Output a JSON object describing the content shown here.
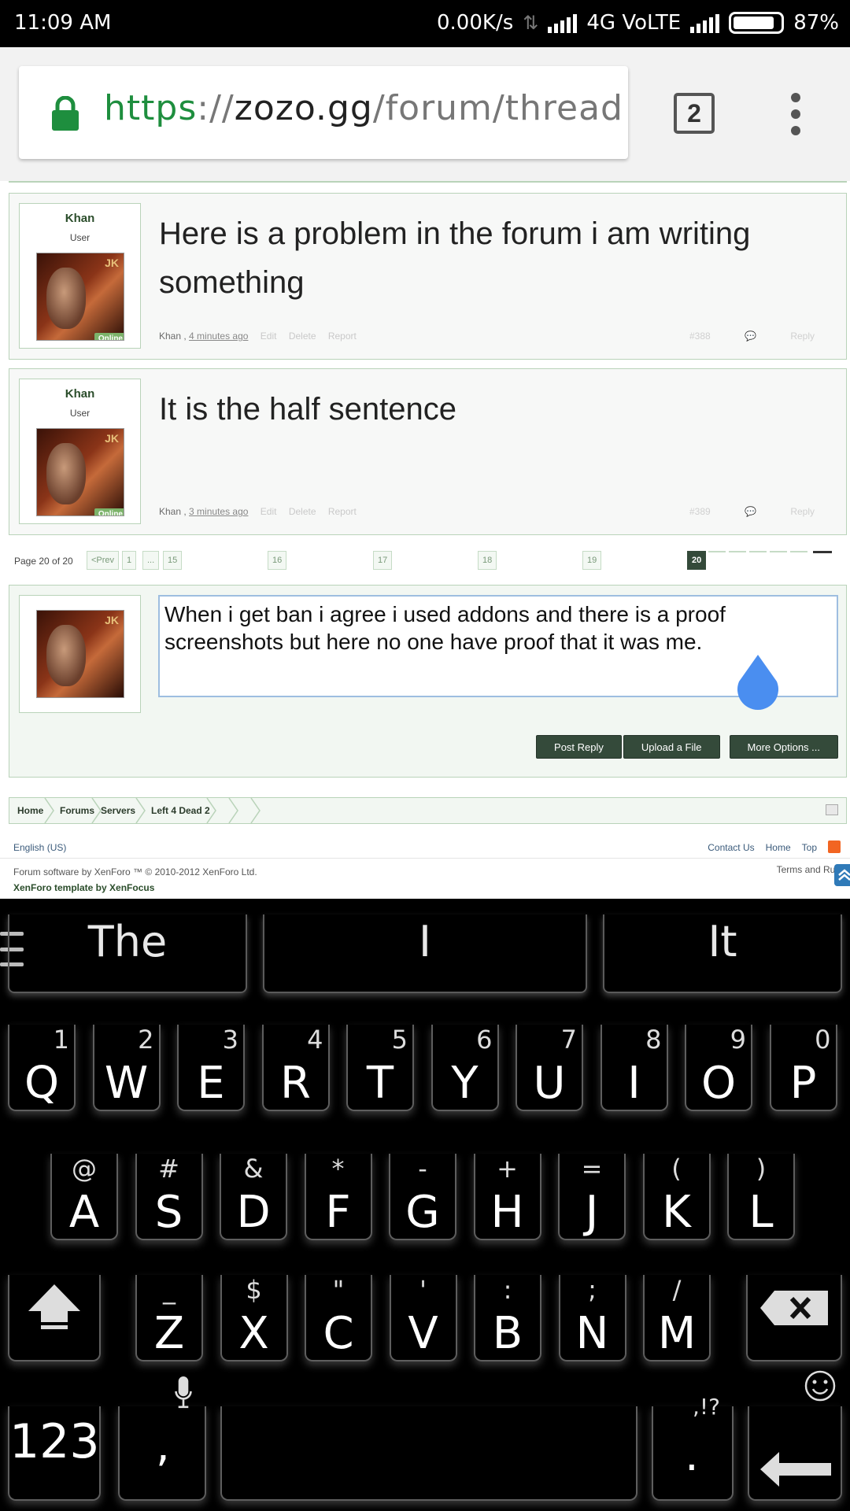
{
  "status_bar": {
    "time": "11:09 AM",
    "net_speed": "0.00K/s",
    "network": "4G VoLTE",
    "battery": "87%"
  },
  "browser": {
    "url_scheme": "https",
    "url_sep": "://",
    "url_host": "zozo.gg",
    "url_path": "/forum/thread",
    "tab_count": "2"
  },
  "posts": [
    {
      "username": "Khan",
      "role": "User",
      "online_badge": "Online",
      "message": "Here is a problem in the forum i am writing something",
      "author": "Khan",
      "time": "4 minutes ago",
      "actions": [
        "Edit",
        "Delete",
        "Report"
      ],
      "number": "#388",
      "reply_label": "Reply"
    },
    {
      "username": "Khan",
      "role": "User",
      "online_badge": "Online",
      "message": "It is the half sentence",
      "author": "Khan",
      "time": "3 minutes ago",
      "actions": [
        "Edit",
        "Delete",
        "Report"
      ],
      "number": "#389",
      "reply_label": "Reply"
    }
  ],
  "pagination": {
    "label": "Page 20 of 20",
    "prev": "<Prev",
    "first": "1",
    "ellipsis": "...",
    "pages": [
      "15",
      "16",
      "17",
      "18",
      "19"
    ],
    "current": "20"
  },
  "reply_box": {
    "text": "When i get ban i agree i used addons and there is a proof screenshots but  here no one have proof that it was me.",
    "post_reply": "Post Reply",
    "upload": "Upload a File",
    "more_options": "More Options ..."
  },
  "breadcrumb": [
    "Home",
    "Forums",
    "Servers",
    "Left 4 Dead 2"
  ],
  "footer": {
    "language": "English (US)",
    "links": [
      "Contact Us",
      "Home",
      "Top"
    ],
    "copyright": "Forum software by XenForo ™ © 2010-2012 XenForo Ltd.",
    "template": "XenForo template by XenFocus",
    "terms": "Terms and Rul"
  },
  "keyboard": {
    "suggestions": [
      "The",
      "I",
      "It"
    ],
    "row1": [
      {
        "k": "Q",
        "h": "1"
      },
      {
        "k": "W",
        "h": "2"
      },
      {
        "k": "E",
        "h": "3"
      },
      {
        "k": "R",
        "h": "4"
      },
      {
        "k": "T",
        "h": "5"
      },
      {
        "k": "Y",
        "h": "6"
      },
      {
        "k": "U",
        "h": "7"
      },
      {
        "k": "I",
        "h": "8"
      },
      {
        "k": "O",
        "h": "9"
      },
      {
        "k": "P",
        "h": "0"
      }
    ],
    "row2": [
      {
        "k": "A",
        "h": "@"
      },
      {
        "k": "S",
        "h": "#"
      },
      {
        "k": "D",
        "h": "&"
      },
      {
        "k": "F",
        "h": "*"
      },
      {
        "k": "G",
        "h": "-"
      },
      {
        "k": "H",
        "h": "+"
      },
      {
        "k": "J",
        "h": "="
      },
      {
        "k": "K",
        "h": "("
      },
      {
        "k": "L",
        "h": ")"
      }
    ],
    "row3": [
      {
        "k": "Z",
        "h": "_"
      },
      {
        "k": "X",
        "h": "$"
      },
      {
        "k": "C",
        "h": "\""
      },
      {
        "k": "V",
        "h": "'"
      },
      {
        "k": "B",
        "h": ":"
      },
      {
        "k": "N",
        "h": ";"
      },
      {
        "k": "M",
        "h": "/"
      }
    ],
    "numbers_key": "123",
    "comma_key": ",",
    "period_key": ".",
    "punct_hint": ",!?"
  }
}
